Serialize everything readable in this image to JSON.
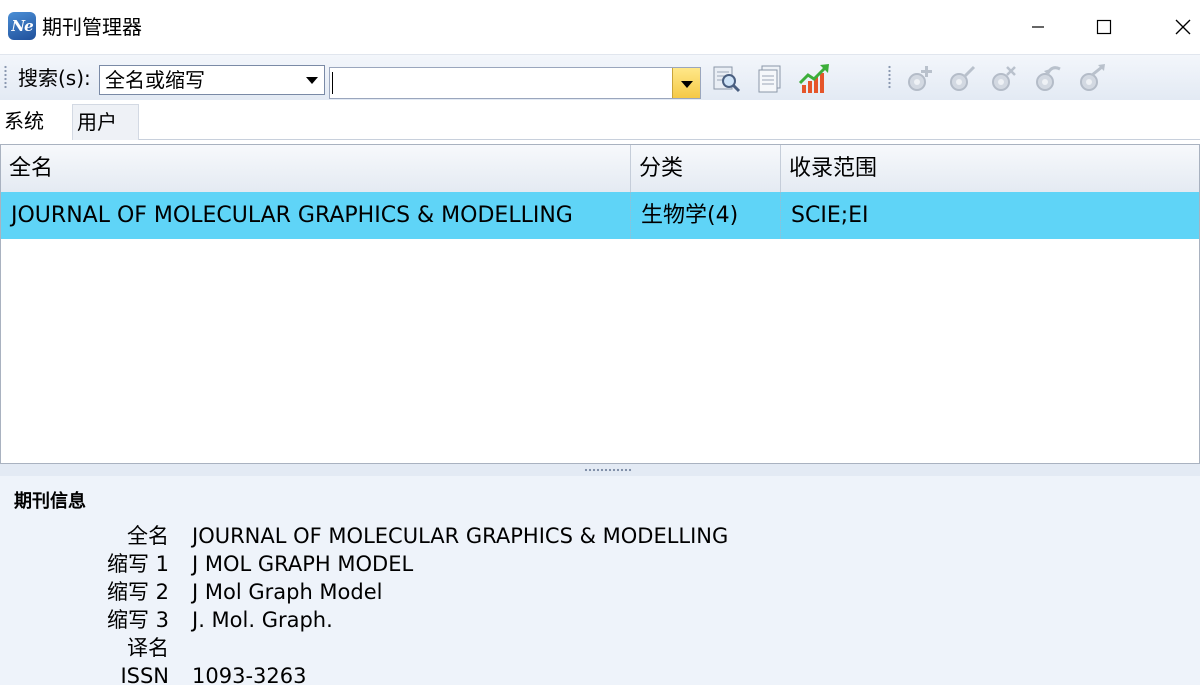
{
  "window": {
    "icon_text": "Ne",
    "title": "期刊管理器"
  },
  "toolbar": {
    "search_label": "搜索(s):",
    "search_field_value": "全名或缩写",
    "search_input_value": "",
    "icons": [
      "search-zoom-icon",
      "database-icon",
      "trend-chart-icon",
      "add-gear-icon",
      "edit-gear-icon",
      "delete-gear-icon",
      "import-gear-icon",
      "export-gear-icon"
    ]
  },
  "tabs": [
    {
      "label": "系统",
      "active": true
    },
    {
      "label": "用户",
      "active": false
    }
  ],
  "grid": {
    "columns": [
      "全名",
      "分类",
      "收录范围"
    ],
    "rows": [
      {
        "full_name": "JOURNAL OF MOLECULAR GRAPHICS & MODELLING",
        "category": "生物学(4)",
        "coverage": "SCIE;EI",
        "selected": true
      }
    ]
  },
  "details": {
    "title": "期刊信息",
    "fields": [
      {
        "label": "全名",
        "value": "JOURNAL OF MOLECULAR GRAPHICS & MODELLING"
      },
      {
        "label": "缩写 1",
        "value": "J MOL GRAPH MODEL"
      },
      {
        "label": "缩写 2",
        "value": "J Mol Graph Model"
      },
      {
        "label": "缩写 3",
        "value": "J. Mol. Graph."
      },
      {
        "label": "译名",
        "value": ""
      },
      {
        "label": "ISSN",
        "value": "1093-3263"
      }
    ]
  },
  "colors": {
    "selection": "#5fd4f7",
    "toolbar_bg": "#e3eaf4",
    "details_bg": "#eef3fa"
  }
}
